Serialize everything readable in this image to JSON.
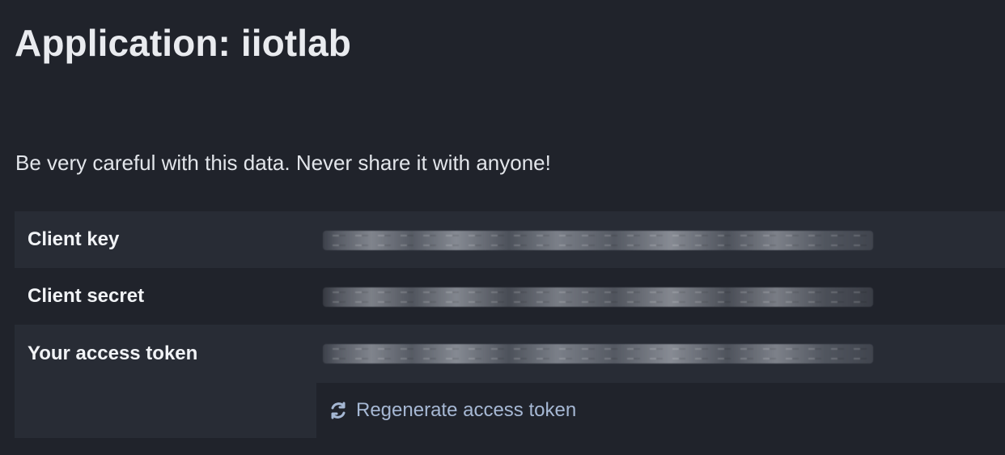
{
  "page": {
    "title": "Application: iiotlab",
    "warning": "Be very careful with this data. Never share it with anyone!"
  },
  "credentials": {
    "client_key": {
      "label": "Client key"
    },
    "client_secret": {
      "label": "Client secret"
    },
    "access_token": {
      "label": "Your access token",
      "action_label": "Regenerate access token"
    }
  },
  "icons": {
    "regenerate": "refresh-icon"
  },
  "colors": {
    "background": "#20232b",
    "row_background": "#282c35",
    "primary_text": "#e9ebef",
    "link": "#a6b8d4"
  }
}
